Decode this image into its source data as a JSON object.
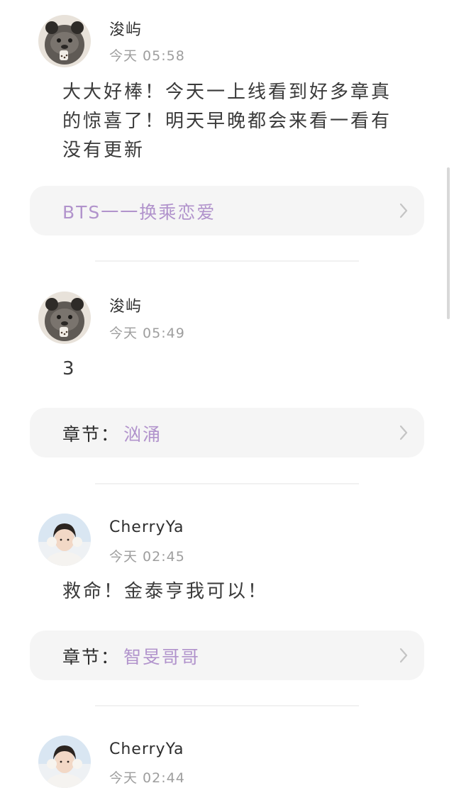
{
  "comments": [
    {
      "username": "浚屿",
      "time": "今天 05:58",
      "text": "大大好棒！今天一上线看到好多章真的惊喜了！明天早晚都会来看一看有没有更新",
      "chapter_label": "",
      "chapter_title": "BTS一一换乘恋爱"
    },
    {
      "username": "浚屿",
      "time": "今天 05:49",
      "text": "3",
      "chapter_label": "章节：",
      "chapter_title": "汹涌"
    },
    {
      "username": "CherryYa",
      "time": "今天 02:45",
      "text": "救命！金泰亨我可以！",
      "chapter_label": "章节：",
      "chapter_title": "智旻哥哥"
    },
    {
      "username": "CherryYa",
      "time": "今天 02:44"
    }
  ],
  "icons": {
    "avatar_1": "panda-bear-avatar",
    "avatar_2": "panda-bear-avatar",
    "avatar_3": "person-avatar",
    "avatar_4": "person-avatar",
    "chevron": "chevron-right-icon"
  },
  "colors": {
    "chapter_title": "#b193cc",
    "card_bg": "#f5f5f5",
    "timestamp": "#9e9e9e"
  }
}
